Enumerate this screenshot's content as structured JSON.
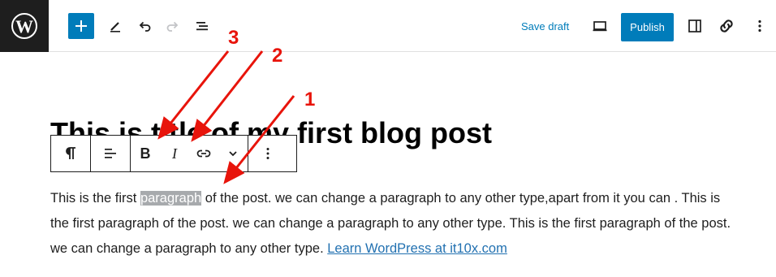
{
  "header": {
    "logo_icon": "wordpress-logo-icon",
    "add_block_icon": "plus-icon",
    "tools_icon": "pencil-icon",
    "undo_icon": "undo-icon",
    "redo_icon": "redo-icon",
    "document_overview_icon": "list-view-icon",
    "save_draft_label": "Save draft",
    "preview_icon": "desktop-preview-icon",
    "publish_label": "Publish",
    "settings_icon": "sidebar-panel-icon",
    "link_icon": "link-icon",
    "options_icon": "more-vertical-icon"
  },
  "post": {
    "title": "This is title of my first blog post",
    "paragraph": {
      "before_highlight": "This is the first ",
      "highlight": "paragraph",
      "after_highlight": " of the post. we can change a paragraph to any other type,apart from it you can . This is the first paragraph of the post. we can change a paragraph to any other type. This is the first paragraph of the post. we can change a paragraph to any other type. ",
      "link_text": "Learn WordPress at it10x.com"
    }
  },
  "block_toolbar": {
    "paragraph_icon": "pilcrow-icon",
    "align_icon": "align-left-icon",
    "bold_label": "B",
    "italic_label": "I",
    "link_icon": "link-icon",
    "more_formatting_icon": "chevron-down-icon",
    "options_icon": "more-vertical-icon"
  },
  "annotations": [
    "1",
    "2",
    "3"
  ],
  "colors": {
    "accent": "#007cba",
    "annotation": "#e8140b",
    "highlight": "#a7aaad",
    "link": "#2271b1"
  }
}
